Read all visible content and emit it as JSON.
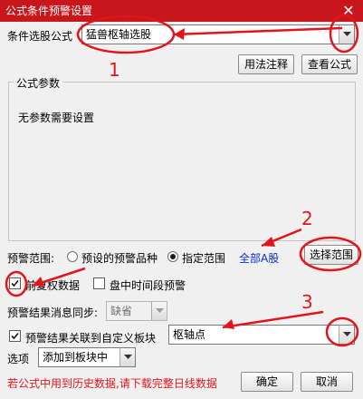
{
  "window": {
    "title": "公式条件预警设置",
    "close_glyph": "✕"
  },
  "formula": {
    "label": "条件选股公式",
    "selected": "猛兽枢轴选股"
  },
  "buttons": {
    "usage_notes": "用法注释",
    "view_formula": "查看公式",
    "select_range": "选择范围",
    "ok": "确定",
    "cancel": "取消"
  },
  "params": {
    "group_title": "公式参数",
    "empty_text": "无参数需要设置"
  },
  "alert_scope": {
    "label": "预警范围:",
    "opt_preset": "预设的预警品种",
    "opt_specified": "指定范围",
    "selected": "指定范围",
    "scope_link": "全部A股"
  },
  "options": {
    "adjusted_data": "前复权数据",
    "adjusted_checked": true,
    "intraday_alert": "盘中时间段预警",
    "intraday_checked": false
  },
  "sync": {
    "label": "预警结果消息同步:",
    "value": "缺省"
  },
  "link_block": {
    "label": "预警结果关联到自定义板块",
    "checked": true,
    "block_value": "枢轴点"
  },
  "item_option": {
    "label": "选项",
    "value": "添加到板块中"
  },
  "warning": "若公式中用到历史数据,请下载完整日线数据",
  "annotations": {
    "n1": "1",
    "n2": "2",
    "n3": "3"
  },
  "colors": {
    "titlebar": "#c8161c",
    "annotation": "#e2151c",
    "link": "#0a2ed9"
  }
}
